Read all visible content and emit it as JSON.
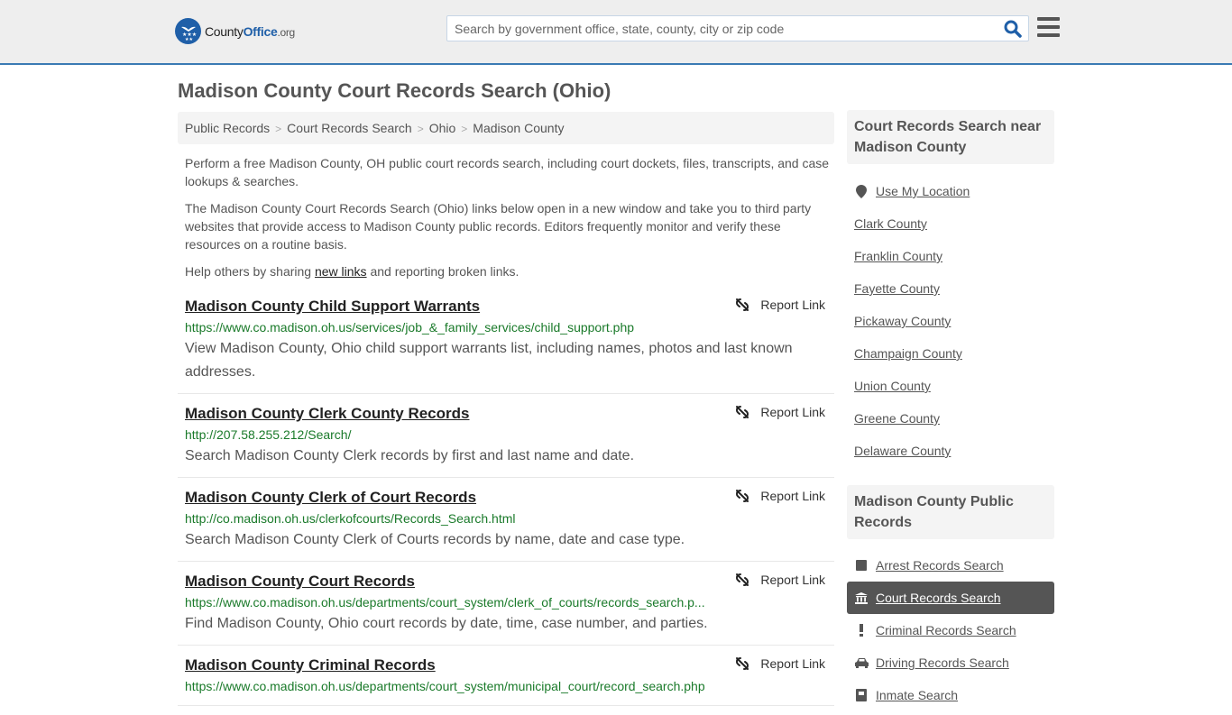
{
  "header": {
    "logo": {
      "name_part1": "County",
      "name_part2": "Office",
      "suffix": ".org"
    },
    "search": {
      "placeholder": "Search by government office, state, county, city or zip code",
      "value": ""
    },
    "brand_color": "#1f5fa8",
    "accent_border_color": "#3a7ab3"
  },
  "page": {
    "title": "Madison County Court Records Search (Ohio)"
  },
  "breadcrumb": [
    {
      "label": "Public Records"
    },
    {
      "label": "Court Records Search"
    },
    {
      "label": "Ohio"
    },
    {
      "label": "Madison County"
    }
  ],
  "intro": {
    "p1": "Perform a free Madison County, OH public court records search, including court dockets, files, transcripts, and case lookups & searches.",
    "p2": "The Madison County Court Records Search (Ohio) links below open in a new window and take you to third party websites that provide access to Madison County public records. Editors frequently monitor and verify these resources on a routine basis.",
    "p3_before": "Help others by sharing ",
    "p3_link": "new links",
    "p3_after": " and reporting broken links."
  },
  "results": [
    {
      "title": "Madison County Child Support Warrants",
      "url": "https://www.co.madison.oh.us/services/job_&_family_services/child_support.php",
      "description": "View Madison County, Ohio child support warrants list, including names, photos and last known addresses.",
      "report_label": "Report Link"
    },
    {
      "title": "Madison County Clerk County Records",
      "url": "http://207.58.255.212/Search/",
      "description": "Search Madison County Clerk records by first and last name and date.",
      "report_label": "Report Link"
    },
    {
      "title": "Madison County Clerk of Court Records",
      "url": "http://co.madison.oh.us/clerkofcourts/Records_Search.html",
      "description": "Search Madison County Clerk of Courts records by name, date and case type.",
      "report_label": "Report Link"
    },
    {
      "title": "Madison County Court Records",
      "url": "https://www.co.madison.oh.us/departments/court_system/clerk_of_courts/records_search.p...",
      "description": "Find Madison County, Ohio court records by date, time, case number, and parties.",
      "report_label": "Report Link"
    },
    {
      "title": "Madison County Criminal Records",
      "url": "https://www.co.madison.oh.us/departments/court_system/municipal_court/record_search.php",
      "description": "",
      "report_label": "Report Link"
    }
  ],
  "sidebar": {
    "nearby": {
      "heading": "Court Records Search near Madison County",
      "use_location": "Use My Location",
      "counties": [
        "Clark County",
        "Franklin County",
        "Fayette County",
        "Pickaway County",
        "Champaign County",
        "Union County",
        "Greene County",
        "Delaware County"
      ]
    },
    "public_records": {
      "heading": "Madison County Public Records",
      "items": [
        {
          "label": "Arrest Records Search",
          "icon": "square-icon",
          "active": false
        },
        {
          "label": "Court Records Search",
          "icon": "courthouse-icon",
          "active": true
        },
        {
          "label": "Criminal Records Search",
          "icon": "exclamation-icon",
          "active": false
        },
        {
          "label": "Driving Records Search",
          "icon": "car-icon",
          "active": false
        },
        {
          "label": "Inmate Search",
          "icon": "inmate-icon",
          "active": false
        }
      ]
    }
  }
}
